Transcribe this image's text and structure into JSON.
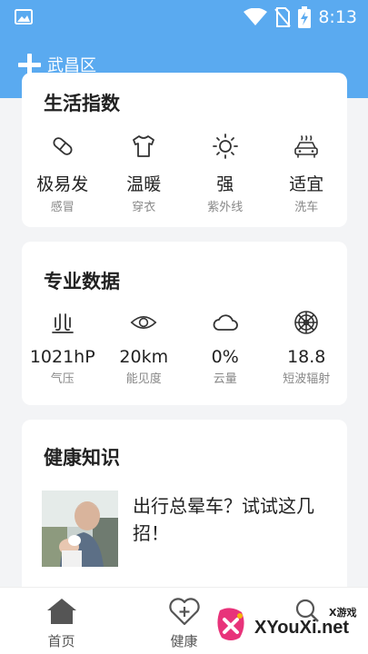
{
  "status_bar": {
    "time": "8:13"
  },
  "app_bar": {
    "city": "武昌区"
  },
  "life_index": {
    "title": "生活指数",
    "items": [
      {
        "value": "极易发",
        "label": "感冒",
        "icon": "pill-icon"
      },
      {
        "value": "温暖",
        "label": "穿衣",
        "icon": "tshirt-icon"
      },
      {
        "value": "强",
        "label": "紫外线",
        "icon": "sun-icon"
      },
      {
        "value": "适宜",
        "label": "洗车",
        "icon": "car-icon"
      }
    ]
  },
  "pro_data": {
    "title": "专业数据",
    "items": [
      {
        "value": "1021hP",
        "label": "气压",
        "icon": "pressure-icon"
      },
      {
        "value": "20km",
        "label": "能见度",
        "icon": "eye-icon"
      },
      {
        "value": "0%",
        "label": "云量",
        "icon": "cloud-icon"
      },
      {
        "value": "18.8",
        "label": "短波辐射",
        "icon": "radiation-icon"
      }
    ]
  },
  "health": {
    "title": "健康知识",
    "article": {
      "title": "出行总晕车？试试这几招！"
    }
  },
  "bottom_nav": [
    {
      "label": "首页",
      "icon": "home-icon"
    },
    {
      "label": "健康",
      "icon": "heart-plus-icon"
    },
    {
      "label": "",
      "icon": "search-icon"
    }
  ],
  "watermark": {
    "text": "XYouXi.net",
    "small": "X游戏"
  },
  "colors": {
    "primary": "#5aaaf0",
    "background": "#f3f4f6"
  }
}
